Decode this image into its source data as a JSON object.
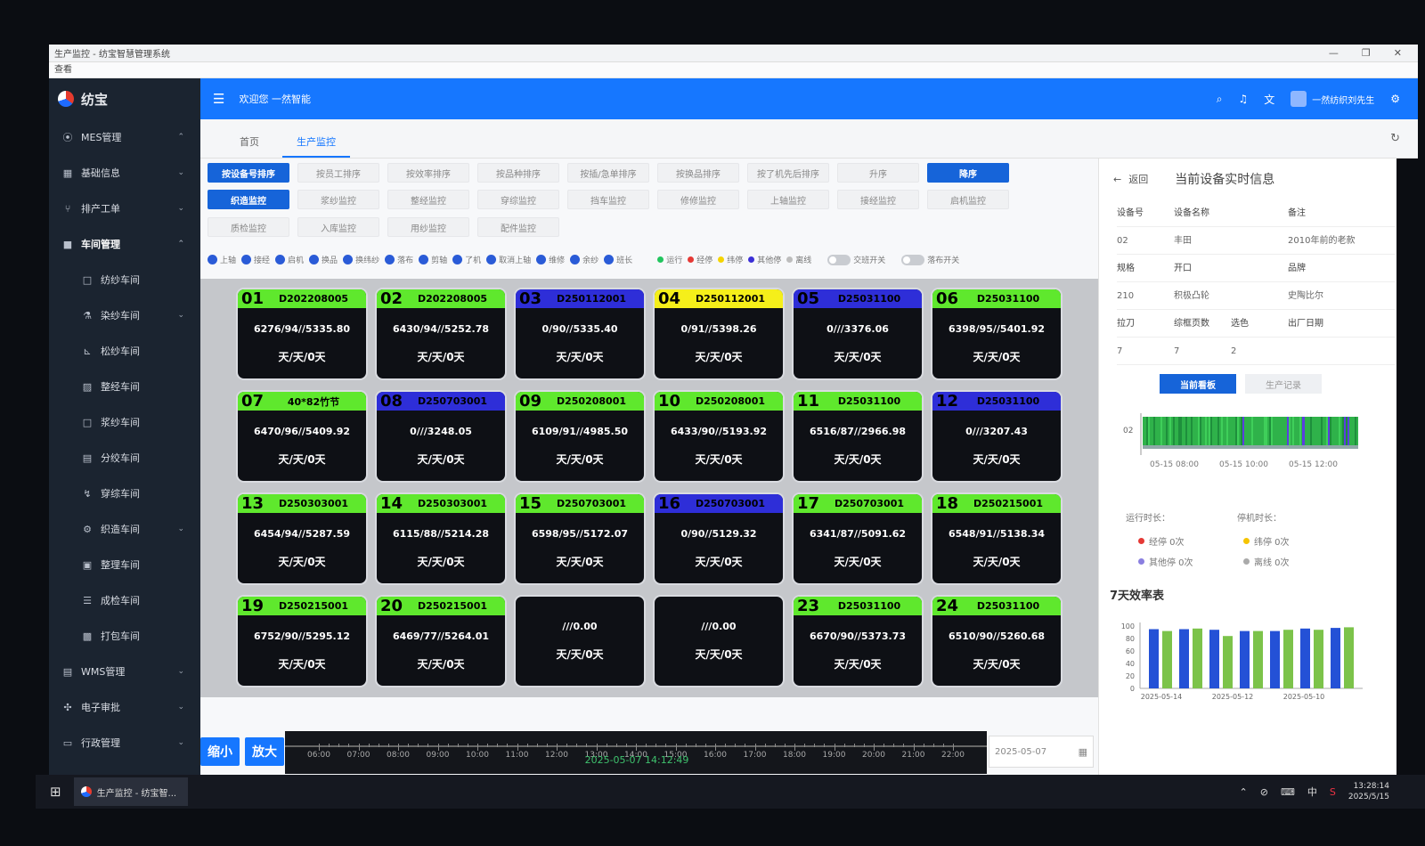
{
  "window": {
    "title": "生产监控 - 纺宝智慧管理系统",
    "menu": "查看",
    "controls": [
      "—",
      "❐",
      "✕"
    ]
  },
  "sidebar": {
    "logo": "纺宝",
    "items": [
      {
        "icon": "location-icon",
        "glyph": "⦿",
        "label": "MES管理",
        "chev": "⌃"
      },
      {
        "icon": "grid-icon",
        "glyph": "▦",
        "label": "基础信息",
        "chev": "⌄"
      },
      {
        "icon": "fork-icon",
        "glyph": "⑂",
        "label": "排产工单",
        "chev": "⌄"
      },
      {
        "icon": "square-icon",
        "glyph": "■",
        "label": "车间管理",
        "chev": "⌃"
      },
      {
        "icon": "box-icon",
        "glyph": "□",
        "label": "纺纱车间",
        "chev": "",
        "sub": true
      },
      {
        "icon": "dye-icon",
        "glyph": "⚗",
        "label": "染纱车间",
        "chev": "⌄",
        "sub": true
      },
      {
        "icon": "chart-icon",
        "glyph": "⊾",
        "label": "松纱车间",
        "chev": "",
        "sub": true
      },
      {
        "icon": "image-icon",
        "glyph": "▨",
        "label": "整经车间",
        "chev": "",
        "sub": true
      },
      {
        "icon": "box-icon",
        "glyph": "□",
        "label": "浆纱车间",
        "chev": "",
        "sub": true
      },
      {
        "icon": "film-icon",
        "glyph": "▤",
        "label": "分绞车间",
        "chev": "",
        "sub": true
      },
      {
        "icon": "thread-icon",
        "glyph": "↯",
        "label": "穿综车间",
        "chev": "",
        "sub": true
      },
      {
        "icon": "gear-icon",
        "glyph": "⚙",
        "label": "织造车间",
        "chev": "⌄",
        "sub": true
      },
      {
        "icon": "card-icon",
        "glyph": "▣",
        "label": "整理车间",
        "chev": "",
        "sub": true
      },
      {
        "icon": "list-icon",
        "glyph": "☰",
        "label": "成检车间",
        "chev": "",
        "sub": true
      },
      {
        "icon": "package-icon",
        "glyph": "▩",
        "label": "打包车间",
        "chev": "",
        "sub": true
      },
      {
        "icon": "doc-icon",
        "glyph": "▤",
        "label": "WMS管理",
        "chev": "⌄"
      },
      {
        "icon": "approve-icon",
        "glyph": "✣",
        "label": "电子审批",
        "chev": "⌄"
      },
      {
        "icon": "monitor-icon",
        "glyph": "▭",
        "label": "行政管理",
        "chev": "⌄"
      }
    ]
  },
  "header": {
    "welcome": "欢迎您 一然智能",
    "user": "一然纺织刘先生"
  },
  "tabs": [
    {
      "label": "首页",
      "active": false
    },
    {
      "label": "生产监控",
      "active": true
    }
  ],
  "sort_buttons": [
    {
      "label": "按设备号排序",
      "on": true
    },
    {
      "label": "按员工排序",
      "on": false
    },
    {
      "label": "按效率排序",
      "on": false
    },
    {
      "label": "按品种排序",
      "on": false
    },
    {
      "label": "按插/急单排序",
      "on": false
    },
    {
      "label": "按换品排序",
      "on": false
    },
    {
      "label": "按了机先后排序",
      "on": false
    },
    {
      "label": "升序",
      "on": false
    },
    {
      "label": "降序",
      "on": true
    }
  ],
  "monitor_buttons": [
    {
      "label": "织造监控",
      "on": true
    },
    {
      "label": "浆纱监控",
      "on": false
    },
    {
      "label": "整经监控",
      "on": false
    },
    {
      "label": "穿综监控",
      "on": false
    },
    {
      "label": "挡车监控",
      "on": false
    },
    {
      "label": "修修监控",
      "on": false
    },
    {
      "label": "上轴监控",
      "on": false
    },
    {
      "label": "接经监控",
      "on": false
    },
    {
      "label": "启机监控",
      "on": false
    }
  ],
  "extra_buttons": [
    {
      "label": "质检监控"
    },
    {
      "label": "入库监控"
    },
    {
      "label": "用纱监控"
    },
    {
      "label": "配件监控"
    }
  ],
  "legend_icons": [
    "上轴",
    "接经",
    "启机",
    "换品",
    "换纬纱",
    "落布",
    "剪轴",
    "了机",
    "取消上轴",
    "维修",
    "余纱",
    "班长"
  ],
  "legend_status": [
    {
      "label": "运行",
      "color": "#22c55e"
    },
    {
      "label": "经停",
      "color": "#e53935"
    },
    {
      "label": "纬停",
      "color": "#f5d400"
    },
    {
      "label": "其他停",
      "color": "#3b2fd6"
    },
    {
      "label": "离线",
      "color": "#bdbdbd"
    }
  ],
  "toggles": [
    "交班开关",
    "落布开关"
  ],
  "machines": [
    {
      "num": "01",
      "code": "D202208005",
      "stat": "6276/94//5335.80",
      "days": "天/天/0天",
      "color": "#5fe82d"
    },
    {
      "num": "02",
      "code": "D202208005",
      "stat": "6430/94//5252.78",
      "days": "天/天/0天",
      "color": "#5fe82d"
    },
    {
      "num": "03",
      "code": "D250112001",
      "stat": "0/90//5335.40",
      "days": "天/天/0天",
      "color": "#2e2ed8"
    },
    {
      "num": "04",
      "code": "D250112001",
      "stat": "0/91//5398.26",
      "days": "天/天/0天",
      "color": "#f5ef1a"
    },
    {
      "num": "05",
      "code": "D25031100",
      "stat": "0///3376.06",
      "days": "天/天/0天",
      "color": "#2e2ed8"
    },
    {
      "num": "06",
      "code": "D25031100",
      "stat": "6398/95//5401.92",
      "days": "天/天/0天",
      "color": "#5fe82d"
    },
    {
      "num": "07",
      "code": "40*82竹节",
      "stat": "6470/96//5409.92",
      "days": "天/天/0天",
      "color": "#5fe82d"
    },
    {
      "num": "08",
      "code": "D250703001",
      "stat": "0///3248.05",
      "days": "天/天/0天",
      "color": "#2e2ed8"
    },
    {
      "num": "09",
      "code": "D250208001",
      "stat": "6109/91//4985.50",
      "days": "天/天/0天",
      "color": "#5fe82d"
    },
    {
      "num": "10",
      "code": "D250208001",
      "stat": "6433/90//5193.92",
      "days": "天/天/0天",
      "color": "#5fe82d"
    },
    {
      "num": "11",
      "code": "D25031100",
      "stat": "6516/87//2966.98",
      "days": "天/天/0天",
      "color": "#5fe82d"
    },
    {
      "num": "12",
      "code": "D25031100",
      "stat": "0///3207.43",
      "days": "天/天/0天",
      "color": "#2e2ed8"
    },
    {
      "num": "13",
      "code": "D250303001",
      "stat": "6454/94//5287.59",
      "days": "天/天/0天",
      "color": "#5fe82d"
    },
    {
      "num": "14",
      "code": "D250303001",
      "stat": "6115/88//5214.28",
      "days": "天/天/0天",
      "color": "#5fe82d"
    },
    {
      "num": "15",
      "code": "D250703001",
      "stat": "6598/95//5172.07",
      "days": "天/天/0天",
      "color": "#5fe82d"
    },
    {
      "num": "16",
      "code": "D250703001",
      "stat": "0/90//5129.32",
      "days": "天/天/0天",
      "color": "#2e2ed8"
    },
    {
      "num": "17",
      "code": "D250703001",
      "stat": "6341/87//5091.62",
      "days": "天/天/0天",
      "color": "#5fe82d"
    },
    {
      "num": "18",
      "code": "D250215001",
      "stat": "6548/91//5138.34",
      "days": "天/天/0天",
      "color": "#5fe82d"
    },
    {
      "num": "19",
      "code": "D250215001",
      "stat": "6752/90//5295.12",
      "days": "天/天/0天",
      "color": "#5fe82d"
    },
    {
      "num": "20",
      "code": "D250215001",
      "stat": "6469/77//5264.01",
      "days": "天/天/0天",
      "color": "#5fe82d"
    },
    {
      "num": "",
      "code": "",
      "stat": "///0.00",
      "days": "天/天/0天",
      "color": ""
    },
    {
      "num": "",
      "code": "",
      "stat": "///0.00",
      "days": "天/天/0天",
      "color": ""
    },
    {
      "num": "23",
      "code": "D25031100",
      "stat": "6670/90//5373.73",
      "days": "天/天/0天",
      "color": "#5fe82d"
    },
    {
      "num": "24",
      "code": "D25031100",
      "stat": "6510/90//5260.68",
      "days": "天/天/0天",
      "color": "#5fe82d"
    }
  ],
  "zoom": {
    "out": "缩小",
    "in": "放大"
  },
  "timeline": {
    "labels": [
      "06:00",
      "07:00",
      "08:00",
      "09:00",
      "10:00",
      "11:00",
      "12:00",
      "13:00",
      "14:00",
      "15:00",
      "16:00",
      "17:00",
      "18:00",
      "19:00",
      "20:00",
      "21:00",
      "22:00"
    ],
    "now": "2025-05-07 14:12:49"
  },
  "date_picker": {
    "value": "2025-05-07"
  },
  "panel": {
    "back": "返回",
    "title": "当前设备实时信息",
    "info": [
      [
        "设备号",
        "设备名称",
        "备注"
      ],
      [
        "02",
        "丰田",
        "2010年前的老款"
      ],
      [
        "规格",
        "开口",
        "品牌"
      ],
      [
        "210",
        "积极凸轮",
        "史陶比尔"
      ],
      [
        "拉刀",
        "综框页数",
        "选色",
        "出厂日期"
      ],
      [
        "7",
        "7",
        "2",
        ""
      ]
    ],
    "btn_board": "当前看板",
    "btn_records": "生产记录",
    "run_label": "运行时长：",
    "stop_label": "停机时长：",
    "stops": [
      {
        "label": "经停 0次",
        "color": "#e53935"
      },
      {
        "label": "纬停 0次",
        "color": "#f5c400"
      },
      {
        "label": "其他停 0次",
        "color": "#8a7fe0"
      },
      {
        "label": "离线 0次",
        "color": "#aaaaaa"
      }
    ]
  },
  "chart_data": [
    {
      "type": "timeline",
      "ylabel": "02",
      "x_ticks": [
        "05-15 08:00",
        "05-15 10:00",
        "05-15 12:00"
      ],
      "segments": [
        {
          "state": "运行",
          "color": "#2fb24a"
        },
        {
          "state": "其他停",
          "color": "#5b3fe0"
        },
        {
          "state": "离线",
          "color": "#8fa8a8"
        }
      ]
    },
    {
      "type": "bar",
      "title": "7天效率表",
      "ylim": [
        0,
        100
      ],
      "yticks": [
        0,
        20,
        40,
        60,
        80,
        100
      ],
      "categories": [
        "2025-05-14",
        "",
        "2025-05-12",
        "",
        "2025-05-10",
        "",
        ""
      ],
      "x_labels": [
        "2025-05-14",
        "2025-05-12",
        "2025-05-10"
      ],
      "series": [
        {
          "color": "#2451d6",
          "values": [
            95,
            95,
            94,
            92,
            92,
            96,
            97
          ]
        },
        {
          "color": "#7cc34a",
          "values": [
            92,
            96,
            84,
            92,
            94,
            94,
            98
          ]
        }
      ]
    }
  ],
  "taskbar": {
    "app": "生产监控 - 纺宝智...",
    "ime": "中",
    "time": "13:28:14",
    "date": "2025/5/15"
  }
}
